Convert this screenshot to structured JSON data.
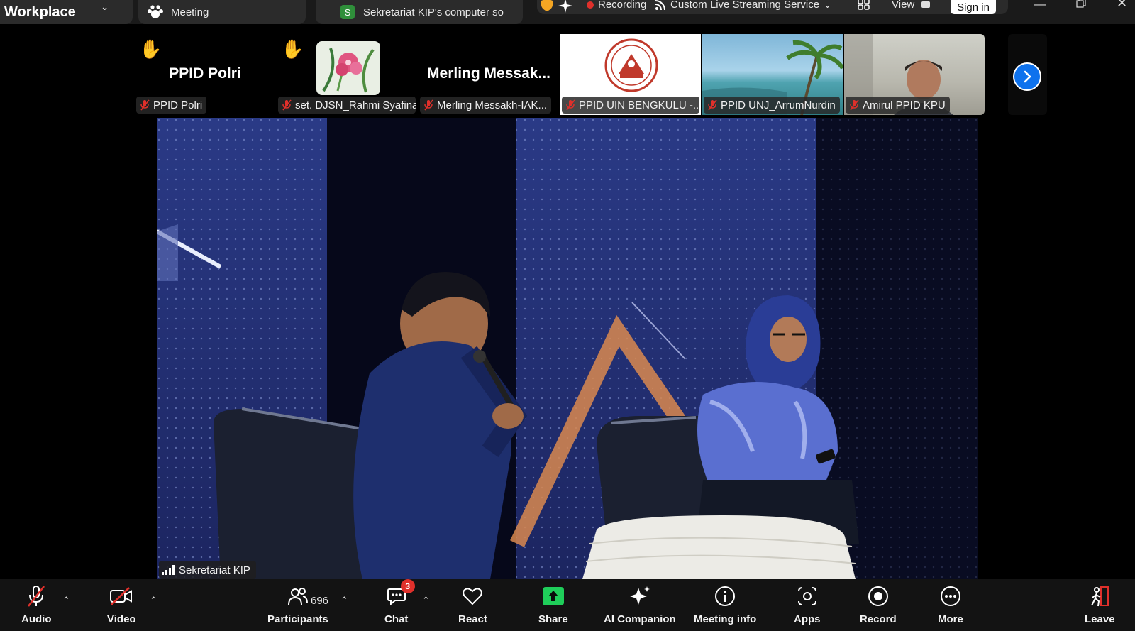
{
  "titlebar": {
    "app_name": "Workplace",
    "meeting_tab": "Meeting",
    "share_tab_initial": "S",
    "share_tab_label": "Sekretariat KIP's computer so",
    "recording_label": "Recording",
    "streaming_label": "Custom Live Streaming Service",
    "view_label": "View",
    "sign_in_label": "Sign in"
  },
  "participants_strip": [
    {
      "big_name": "PPID Polri",
      "label": "PPID Polri",
      "hand_raised": true
    },
    {
      "big_name": "",
      "label": "set. DJSN_Rahmi Syafina",
      "hand_raised": true
    },
    {
      "big_name": "Merling  Messak...",
      "label": "Merling Messakh-IAK...",
      "hand_raised": false
    },
    {
      "big_name": "",
      "label": "PPID UIN BENGKULU -...",
      "hand_raised": false
    },
    {
      "big_name": "",
      "label": "PPID UNJ_ArrumNurdin",
      "hand_raised": false
    },
    {
      "big_name": "",
      "label": "Amirul PPID KPU",
      "hand_raised": false
    }
  ],
  "main_video": {
    "speaker_name": "Sekretariat KIP"
  },
  "toolbar": {
    "audio": "Audio",
    "video": "Video",
    "participants": "Participants",
    "participants_count": "696",
    "chat": "Chat",
    "chat_badge": "3",
    "react": "React",
    "share": "Share",
    "ai_companion": "AI Companion",
    "meeting_info": "Meeting info",
    "apps": "Apps",
    "record": "Record",
    "more": "More",
    "leave": "Leave"
  },
  "colors": {
    "accent_blue": "#0e72ed",
    "recording_red": "#e0302b",
    "share_green": "#1fce5a",
    "muted_red": "#e0302b"
  }
}
